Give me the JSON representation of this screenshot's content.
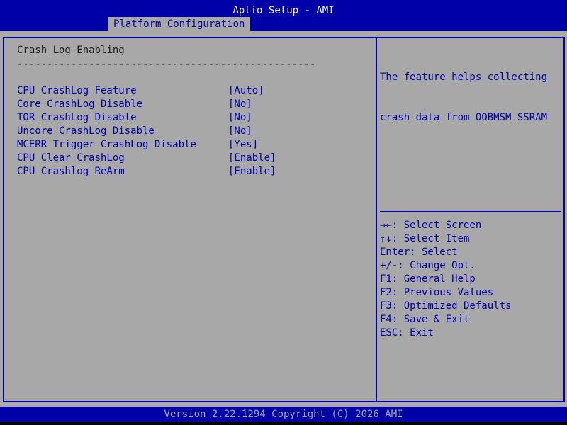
{
  "header": {
    "title": "Aptio Setup - AMI",
    "tab_label": "Platform Configuration"
  },
  "section": {
    "title": "Crash Log Enabling",
    "rule": "--------------------------------------------------"
  },
  "settings": [
    {
      "label": "CPU CrashLog Feature",
      "value": "[Auto]"
    },
    {
      "label": "Core CrashLog Disable",
      "value": "[No]"
    },
    {
      "label": "TOR CrashLog Disable",
      "value": "[No]"
    },
    {
      "label": "Uncore CrashLog Disable",
      "value": "[No]"
    },
    {
      "label": "MCERR Trigger CrashLog Disable",
      "value": "[Yes]"
    },
    {
      "label": "CPU Clear CrashLog",
      "value": "[Enable]"
    },
    {
      "label": "CPU Crashlog ReArm",
      "value": "[Enable]"
    }
  ],
  "help": {
    "line1": "The feature helps collecting",
    "line2": "crash data from OOBMSM SSRAM"
  },
  "key_help": [
    "→←: Select Screen",
    "↑↓: Select Item",
    "Enter: Select",
    "+/-: Change Opt.",
    "F1: General Help",
    "F2: Previous Values",
    "F3: Optimized Defaults",
    "F4: Save & Exit",
    "ESC: Exit"
  ],
  "footer": {
    "text": "Version 2.22.1294 Copyright (C) 2026 AMI"
  },
  "colors": {
    "bios_blue": "#0000a8",
    "panel_gray": "#a8a8a8",
    "text_white": "#ffffff",
    "text_dark": "#1c1c1c"
  }
}
